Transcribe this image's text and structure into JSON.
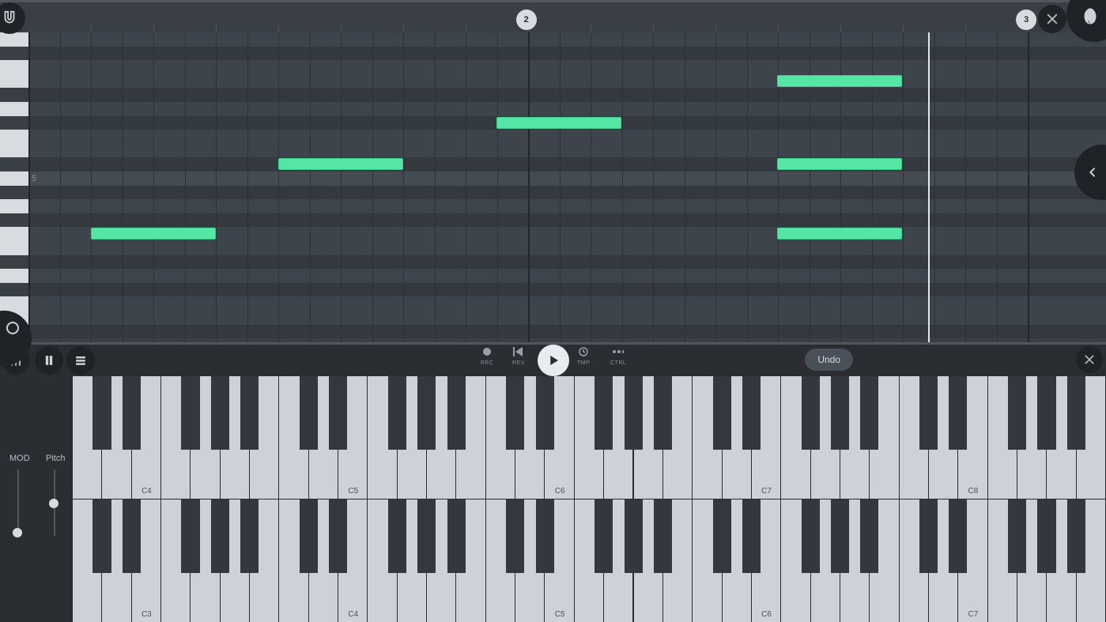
{
  "colors": {
    "note": "#55e6a5",
    "playhead": "#e4e7eb"
  },
  "ruler": {
    "bars": [
      2,
      3
    ]
  },
  "piano_roll": {
    "octave_label": "5",
    "playhead_pos_percent": 83.5,
    "notes": [
      {
        "left_percent": 5.8,
        "width_percent": 11.6,
        "row": 14
      },
      {
        "left_percent": 23.2,
        "width_percent": 11.6,
        "row": 9
      },
      {
        "left_percent": 43.4,
        "width_percent": 11.6,
        "row": 6
      },
      {
        "left_percent": 69.5,
        "width_percent": 11.6,
        "row": 14
      },
      {
        "left_percent": 69.5,
        "width_percent": 11.6,
        "row": 9
      },
      {
        "left_percent": 69.5,
        "width_percent": 11.6,
        "row": 3
      }
    ],
    "row_pattern": [
      "light",
      "dark",
      "light",
      "light",
      "dark",
      "light",
      "dark",
      "light",
      "light",
      "dark",
      "lighter",
      "dark",
      "light",
      "dark",
      "light",
      "light",
      "dark",
      "light",
      "dark",
      "light",
      "light",
      "dark"
    ]
  },
  "transport": {
    "rec_label": "REC",
    "rev_label": "REV",
    "tmp_label": "TMP",
    "ctrl_label": "CTRL",
    "undo_label": "Undo"
  },
  "keyboard": {
    "mod_label": "MOD",
    "pitch_label": "Pitch",
    "top_row_labels": [
      "C4",
      "C5",
      "C6",
      "C7",
      "C8"
    ],
    "bottom_row_labels": [
      "C3",
      "C4",
      "C5",
      "C6",
      "C7"
    ]
  }
}
